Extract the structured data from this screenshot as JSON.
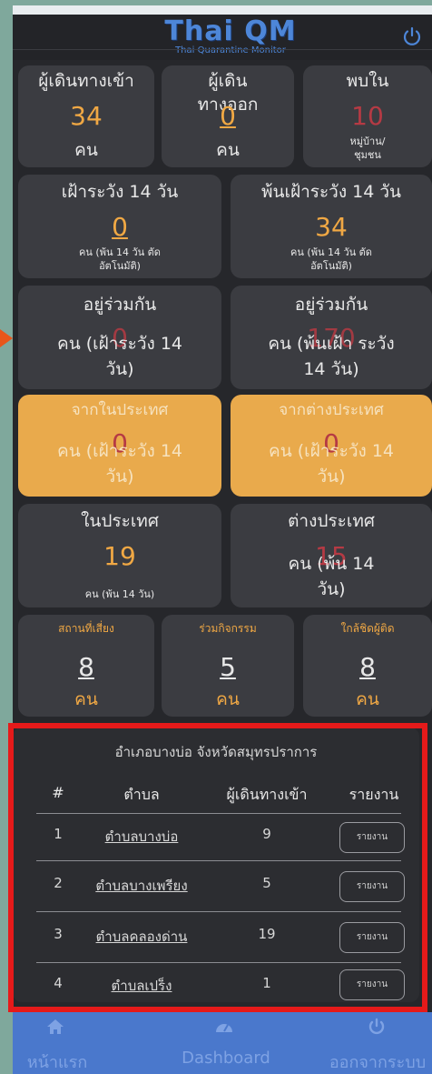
{
  "header": {
    "logo_text": "Thai QM",
    "logo_subtitle": "Thai Quarantine Monitor",
    "power_icon": "power-icon"
  },
  "row1": [
    {
      "title": "ผู้เดินทางเข้า",
      "value": "34",
      "unit": "คน"
    },
    {
      "title": "ผู้เดิน ทางออก",
      "value": "0",
      "unit": "คน"
    },
    {
      "title": "พบใน",
      "value": "10",
      "unit": "หมู่บ้าน/ ชุมชน"
    }
  ],
  "row2": [
    {
      "title": "เฝ้าระวัง 14 วัน",
      "value": "0",
      "note": "คน (พ้น 14 วัน ตัด อัตโนมัติ)"
    },
    {
      "title": "พ้นเฝ้าระวัง 14 วัน",
      "value": "34",
      "note": "คน (พ้น 14 วัน ตัด อัตโนมัติ)"
    }
  ],
  "row3": [
    {
      "title": "อยู่ร่วมกัน",
      "value": "0",
      "unit": "คน (เฝ้าระวัง 14 วัน)"
    },
    {
      "title": "อยู่ร่วมกัน",
      "value": "170",
      "unit": "คน (พ้นเฝ้า ระวัง 14 วัน)"
    }
  ],
  "row4": [
    {
      "title": "จากในประเทศ",
      "value": "0",
      "unit": "คน (เฝ้าระวัง 14 วัน)"
    },
    {
      "title": "จากต่างประเทศ",
      "value": "0",
      "unit": "คน (เฝ้าระวัง 14 วัน)"
    }
  ],
  "row5": [
    {
      "title": "ในประเทศ",
      "value": "19",
      "note": "คน (พ้น 14 วัน)"
    },
    {
      "title": "ต่างประเทศ",
      "value": "15",
      "unit": "คน (พ้น 14 วัน)"
    }
  ],
  "row6": [
    {
      "title": "สถานที่เสี่ยง",
      "value": "8",
      "unit": "คน"
    },
    {
      "title": "ร่วมกิจกรรม",
      "value": "5",
      "unit": "คน"
    },
    {
      "title": "ใกล้ชิดผู้ติด",
      "value": "8",
      "unit": "คน"
    }
  ],
  "table": {
    "caption": "อำเภอบางบ่อ จังหวัดสมุทรปราการ",
    "headers": [
      "#",
      "ตำบล",
      "ผู้เดินทางเข้า",
      "รายงาน"
    ],
    "rows": [
      {
        "no": "1",
        "tambon": "ตำบลบางบ่อ",
        "count": "9",
        "button": "รายงาน"
      },
      {
        "no": "2",
        "tambon": "ตำบลบางเพรียง",
        "count": "5",
        "button": "รายงาน"
      },
      {
        "no": "3",
        "tambon": "ตำบลคลองด่าน",
        "count": "19",
        "button": "รายงาน"
      },
      {
        "no": "4",
        "tambon": "ตำบลเปร็ง",
        "count": "1",
        "button": "รายงาน"
      }
    ]
  },
  "nav": {
    "home": "หน้าแรก",
    "dashboard": "Dashboard",
    "logout": "ออกจากระบบ"
  },
  "colors": {
    "accent": "#f0a844",
    "danger": "#b53a44",
    "card": "#3b3c41",
    "nav": "#4a78cc",
    "highlight": "#e51a1a"
  }
}
